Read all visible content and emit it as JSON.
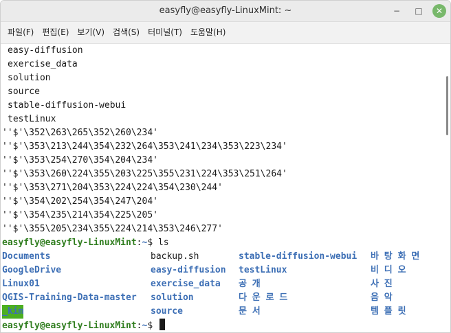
{
  "window": {
    "title": "easyfly@easyfly-LinuxMint: ~",
    "min_glyph": "−",
    "max_glyph": "□",
    "close_glyph": "✕"
  },
  "menu": [
    "파일(F)",
    "편집(E)",
    "보기(V)",
    "검색(S)",
    "터미널(T)",
    "도움말(H)"
  ],
  "output_lines": [
    "easy-diffusion",
    "exercise_data",
    "solution",
    "source",
    "stable-diffusion-webui",
    "testLinux",
    "''$'\\352\\263\\265\\352\\260\\234'",
    "''$'\\353\\213\\244\\354\\232\\264\\353\\241\\234\\353\\223\\234'",
    "''$'\\353\\254\\270\\354\\204\\234'",
    "''$'\\353\\260\\224\\355\\203\\225\\355\\231\\224\\353\\251\\264'",
    "''$'\\353\\271\\204\\353\\224\\224\\354\\230\\244'",
    "''$'\\354\\202\\254\\354\\247\\204'",
    "''$'\\354\\235\\214\\354\\225\\205'",
    "''$'\\355\\205\\234\\355\\224\\214\\353\\246\\277'"
  ],
  "prompt": {
    "user_host": "easyfly@easyfly-LinuxMint",
    "sep": ":",
    "path": "~",
    "symbol": "$ "
  },
  "command": "ls",
  "ls_rows": [
    [
      "Documents",
      "backup.sh",
      "stable-diffusion-webui",
      "바 탕 화 면"
    ],
    [
      "GoogleDrive",
      "easy-diffusion",
      "testLinux",
      "비 디 오"
    ],
    [
      "Linux01",
      "exercise_data",
      "공 개",
      "사 진"
    ],
    [
      "QGIS-Training-Data-master",
      "solution",
      "다 운 로 드",
      "음 악"
    ],
    [
      "_kim",
      "source",
      "문 서",
      "템 플 릿"
    ]
  ],
  "colors": {
    "prompt_user": "#2f7d1e",
    "prompt_path": "#3d6fb5",
    "directory": "#3d6fb5",
    "highlight_bg": "#4caf20",
    "close_button": "#78b86b"
  }
}
